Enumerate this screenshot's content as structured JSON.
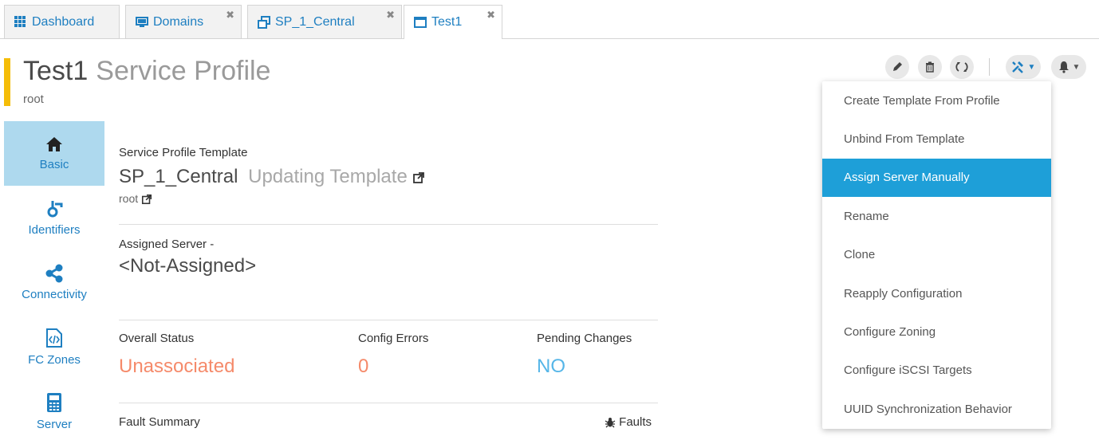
{
  "tabs": [
    {
      "label": "Dashboard",
      "icon": "grid-icon",
      "closable": false
    },
    {
      "label": "Domains",
      "icon": "monitor-icon",
      "closable": true
    },
    {
      "label": "SP_1_Central",
      "icon": "windows-icon",
      "closable": true
    },
    {
      "label": "Test1",
      "icon": "window-icon",
      "closable": true,
      "active": true
    }
  ],
  "tab_close_glyph": "✖",
  "header": {
    "title": "Test1",
    "subtitle": "Service Profile",
    "org": "root",
    "accent_color": "#f5bd08"
  },
  "toolbar": {
    "icons": [
      "edit-icon",
      "delete-icon",
      "refresh-icon",
      "tools-icon",
      "bell-icon"
    ]
  },
  "sidebar": {
    "items": [
      {
        "label": "Basic",
        "icon": "home-icon",
        "active": true
      },
      {
        "label": "Identifiers",
        "icon": "identifier-icon"
      },
      {
        "label": "Connectivity",
        "icon": "share-icon"
      },
      {
        "label": "FC Zones",
        "icon": "code-file-icon"
      },
      {
        "label": "Server",
        "icon": "calculator-icon"
      }
    ]
  },
  "template_section": {
    "label": "Service Profile Template",
    "name": "SP_1_Central",
    "type": "Updating Template",
    "org": "root"
  },
  "assigned_server": {
    "label": "Assigned Server",
    "dash": "-",
    "value": "<Not-Assigned>"
  },
  "status": {
    "overall_label": "Overall Status",
    "overall_value": "Unassociated",
    "overall_color": "#f58a6a",
    "config_errors_label": "Config Errors",
    "config_errors_value": "0",
    "config_errors_color": "#f58a6a",
    "pending_label": "Pending Changes",
    "pending_value": "NO",
    "pending_color": "#56b6e8"
  },
  "fault_summary": {
    "label": "Fault Summary",
    "faults_link": "Faults"
  },
  "menu": {
    "items": [
      {
        "label": "Create Template From Profile"
      },
      {
        "label": "Unbind From Template"
      },
      {
        "label": "Assign Server Manually",
        "selected": true
      },
      {
        "label": "Rename"
      },
      {
        "label": "Clone"
      },
      {
        "label": "Reapply Configuration"
      },
      {
        "label": "Configure Zoning"
      },
      {
        "label": "Configure iSCSI Targets"
      },
      {
        "label": "UUID Synchronization Behavior"
      }
    ]
  },
  "colors": {
    "link": "#1e7fc1",
    "sidebar_active_bg": "#aed9ee",
    "menu_selected_bg": "#1e9fd8"
  }
}
